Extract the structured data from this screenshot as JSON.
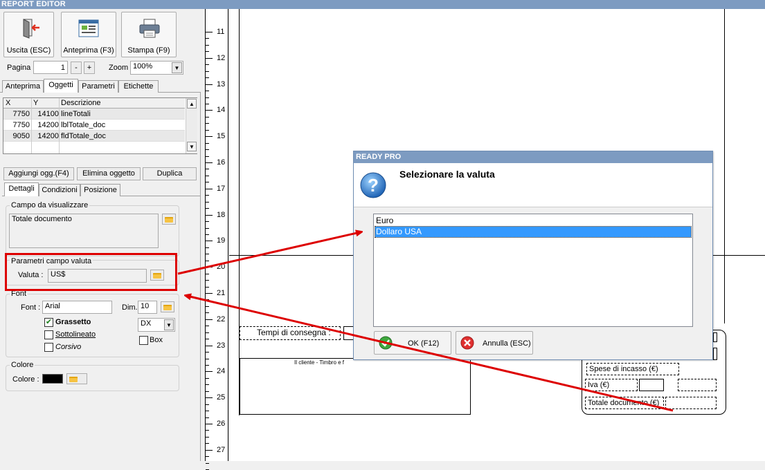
{
  "window": {
    "title": "REPORT EDITOR"
  },
  "toolbar": {
    "exit_label": "Uscita (ESC)",
    "preview_label": "Anteprima (F3)",
    "print_label": "Stampa (F9)"
  },
  "pager": {
    "page_label": "Pagina",
    "page_value": "1",
    "minus_label": "-",
    "plus_label": "+",
    "zoom_label": "Zoom",
    "zoom_value": "100%"
  },
  "top_tabs": [
    "Anteprima",
    "Oggetti",
    "Parametri",
    "Etichette"
  ],
  "objects_table": {
    "headers": [
      "X",
      "Y",
      "Descrizione"
    ],
    "rows": [
      {
        "x": "7750",
        "y": "14100",
        "desc": "lineTotali"
      },
      {
        "x": "7750",
        "y": "14200",
        "desc": "lblTotale_doc"
      },
      {
        "x": "9050",
        "y": "14200",
        "desc": "fldTotale_doc"
      }
    ]
  },
  "object_buttons": {
    "add": "Aggiungi ogg.(F4)",
    "delete": "Elimina oggetto",
    "duplicate": "Duplica"
  },
  "detail_tabs": [
    "Dettagli",
    "Condizioni",
    "Posizione"
  ],
  "field_group": {
    "title": "Campo da visualizzare",
    "value": "Totale documento"
  },
  "currency_group": {
    "title": "Parametri campo valuta",
    "label": "Valuta :",
    "value": "US$"
  },
  "font_group": {
    "title": "Font",
    "font_label": "Font :",
    "font_value": "Arial",
    "size_label": "Dim.",
    "size_value": "10",
    "bold_label": "Grassetto",
    "underline_label": "Sottolineato",
    "italic_label": "Corsivo",
    "align_value": "DX",
    "box_label": "Box"
  },
  "color_group": {
    "title": "Colore",
    "label": "Colore :",
    "swatch": "#000000"
  },
  "ruler": {
    "numbers": [
      "11",
      "12",
      "13",
      "14",
      "15",
      "16",
      "17",
      "18",
      "19",
      "20",
      "21",
      "22",
      "23",
      "24",
      "25",
      "26",
      "27"
    ]
  },
  "report_canvas": {
    "delivery_label": "Tempi di consegna :",
    "customer_label": "Il cliente - Timbro e f",
    "collection_label": "Spese di incasso (€)",
    "vat_label": "Iva (€)",
    "total_label": "Totale documento (€)"
  },
  "dialog": {
    "title": "READY PRO",
    "question": "Selezionare la valuta",
    "options": [
      "Euro",
      "Dollaro USA"
    ],
    "selected_index": 1,
    "ok_label": "OK (F12)",
    "cancel_label": "Annulla (ESC)"
  },
  "colors": {
    "titlebar": "#7d9bc1",
    "selection": "#3399ff",
    "annotation": "#dd0000"
  }
}
